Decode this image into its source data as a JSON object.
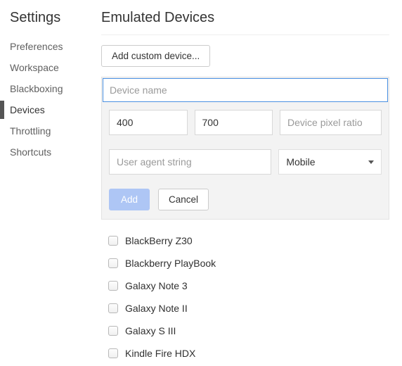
{
  "sidebar": {
    "title": "Settings",
    "items": [
      {
        "label": "Preferences",
        "active": false
      },
      {
        "label": "Workspace",
        "active": false
      },
      {
        "label": "Blackboxing",
        "active": false
      },
      {
        "label": "Devices",
        "active": true
      },
      {
        "label": "Throttling",
        "active": false
      },
      {
        "label": "Shortcuts",
        "active": false
      }
    ]
  },
  "main": {
    "title": "Emulated Devices",
    "add_custom_label": "Add custom device...",
    "form": {
      "device_name_placeholder": "Device name",
      "device_name_value": "",
      "width_value": "400",
      "height_value": "700",
      "dpr_placeholder": "Device pixel ratio",
      "dpr_value": "",
      "ua_value": "",
      "ua_placeholder": "User agent string",
      "type_selected": "Mobile",
      "add_label": "Add",
      "cancel_label": "Cancel"
    },
    "devices": [
      {
        "label": "BlackBerry Z30",
        "checked": false
      },
      {
        "label": "Blackberry PlayBook",
        "checked": false
      },
      {
        "label": "Galaxy Note 3",
        "checked": false
      },
      {
        "label": "Galaxy Note II",
        "checked": false
      },
      {
        "label": "Galaxy S III",
        "checked": false
      },
      {
        "label": "Kindle Fire HDX",
        "checked": false
      }
    ]
  }
}
